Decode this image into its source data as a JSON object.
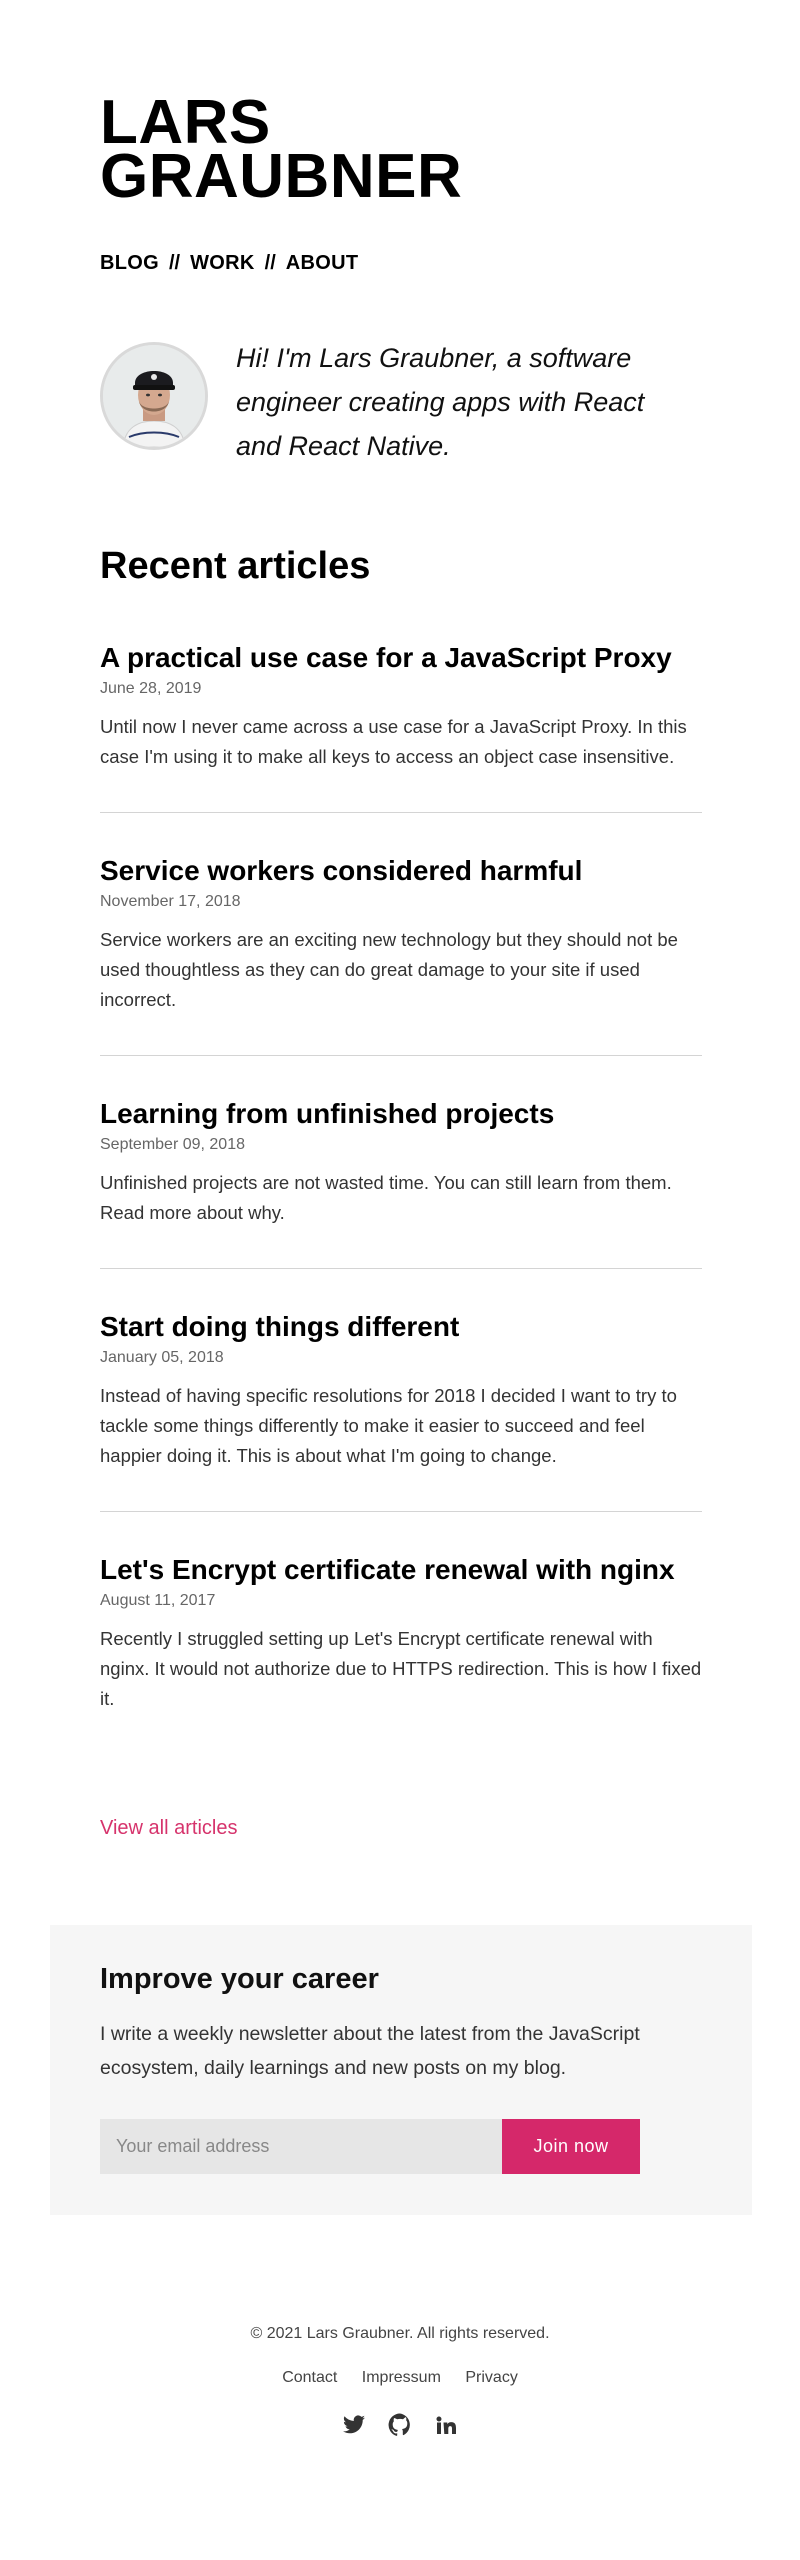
{
  "header": {
    "title_line1": "LARS",
    "title_line2": "GRAUBNER"
  },
  "nav": {
    "items": [
      {
        "label": "BLOG"
      },
      {
        "label": "WORK"
      },
      {
        "label": "ABOUT"
      }
    ],
    "separator": "//"
  },
  "intro": {
    "text": "Hi! I'm Lars Graubner, a software engineer creating apps with React and React Native."
  },
  "recent": {
    "title": "Recent articles",
    "articles": [
      {
        "title": "A practical use case for a JavaScript Proxy",
        "date": "June 28, 2019",
        "excerpt": "Until now I never came across a use case for a JavaScript Proxy. In this case I'm using it to make all keys to access an object case insensitive."
      },
      {
        "title": "Service workers considered harmful",
        "date": "November 17, 2018",
        "excerpt": "Service workers are an exciting new technology but they should not be used thoughtless as they can do great damage to your site if used incorrect."
      },
      {
        "title": "Learning from unfinished projects",
        "date": "September 09, 2018",
        "excerpt": "Unfinished projects are not wasted time. You can still learn from them. Read more about why."
      },
      {
        "title": "Start doing things different",
        "date": "January 05, 2018",
        "excerpt": "Instead of having specific resolutions for 2018 I decided I want to try to tackle some things differently to make it easier to succeed and feel happier doing it. This is about what I'm going to change."
      },
      {
        "title": "Let's Encrypt certificate renewal with nginx",
        "date": "August 11, 2017",
        "excerpt": "Recently I struggled setting up Let's Encrypt certificate renewal with nginx. It would not authorize due to HTTPS redirection. This is how I fixed it."
      }
    ],
    "view_all": "View all articles"
  },
  "newsletter": {
    "title": "Improve your career",
    "text": "I write a weekly newsletter about the latest from the JavaScript ecosystem, daily learnings and new posts on my blog.",
    "email_placeholder": "Your email address",
    "email_value": "",
    "button_label": "Join now"
  },
  "footer": {
    "copyright": "© 2021 Lars Graubner. All rights reserved.",
    "links": [
      {
        "label": "Contact"
      },
      {
        "label": "Impressum"
      },
      {
        "label": "Privacy"
      }
    ],
    "social_icons": [
      "twitter-icon",
      "github-icon",
      "linkedin-icon"
    ]
  },
  "colors": {
    "accent": "#d5286a",
    "link": "#d6336c",
    "newsletter_bg": "#f6f6f6",
    "input_bg": "#e6e6e6",
    "divider": "#d4d4d4"
  }
}
